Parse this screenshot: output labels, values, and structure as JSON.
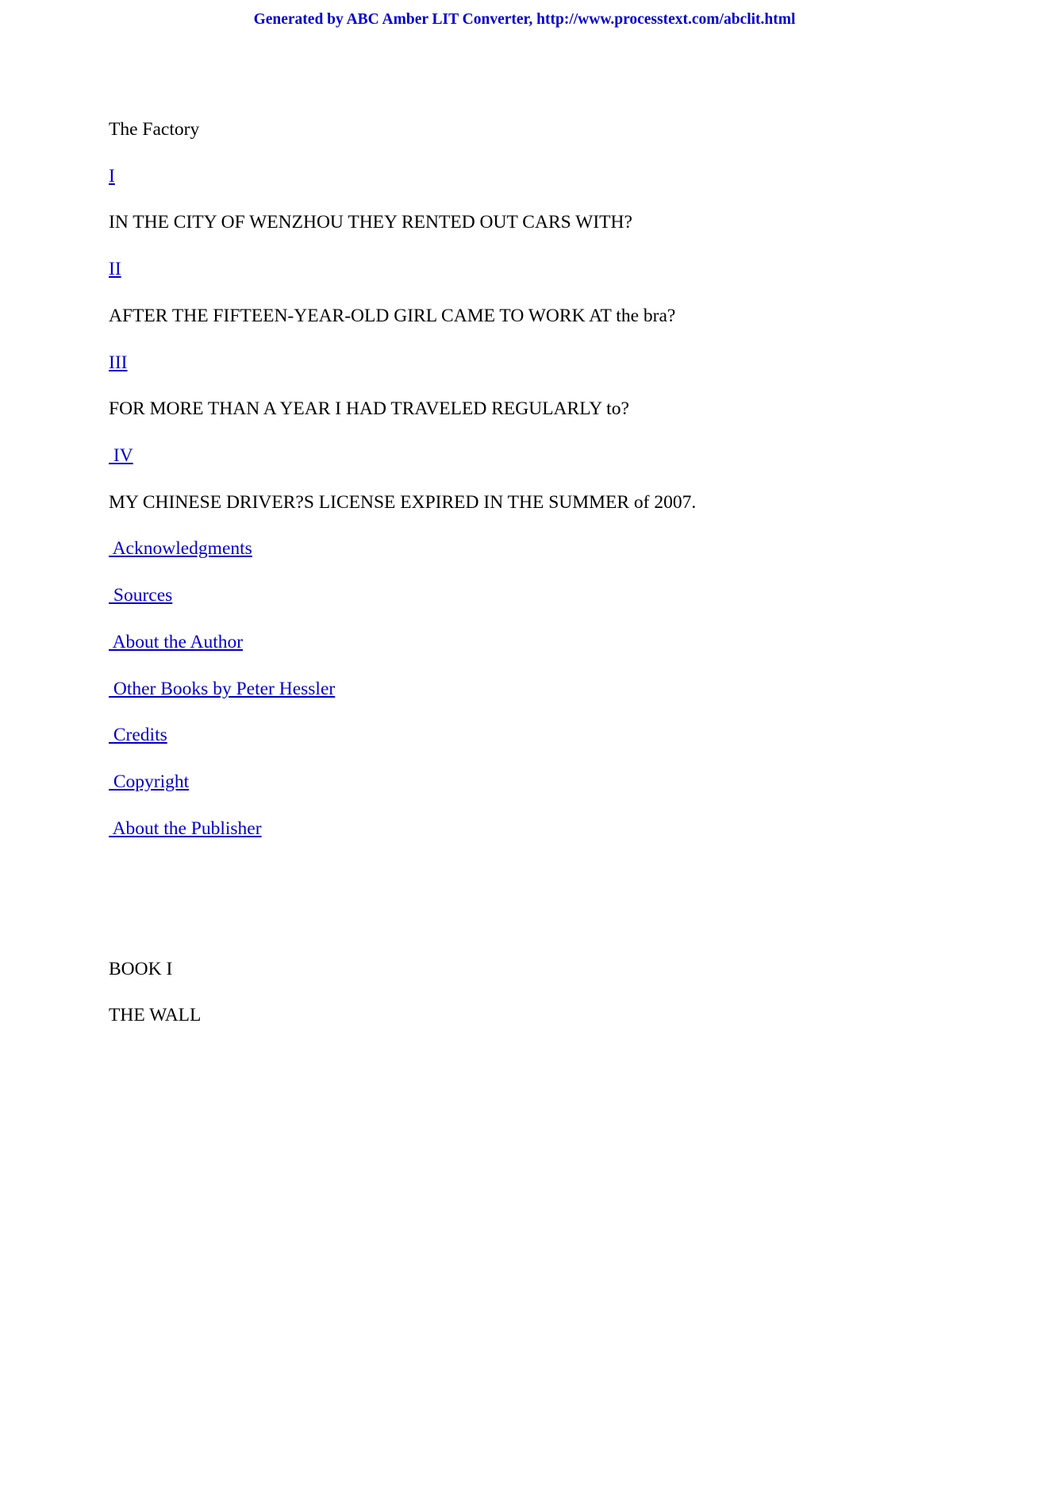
{
  "header": {
    "banner_text": "Generated by ABC Amber LIT Converter, http://www.processtext.com/abclit.html",
    "banner_color": "#0000cc"
  },
  "document": {
    "title": "The Factory",
    "link_color": "#0000cc",
    "text_color": "#000000",
    "background_color": "#ffffff",
    "toc": [
      {
        "link": "I",
        "summary": "IN THE CITY OF WENZHOU THEY RENTED OUT CARS WITH?"
      },
      {
        "link": "II",
        "summary": "AFTER THE FIFTEEN-YEAR-OLD GIRL CAME TO WORK AT the bra?"
      },
      {
        "link": "III",
        "summary": "FOR MORE THAN A YEAR I HAD TRAVELED REGULARLY to?"
      },
      {
        "link": " IV",
        "summary": "MY CHINESE DRIVER?S LICENSE EXPIRED IN THE SUMMER of 2007."
      }
    ],
    "back_matter_links": [
      " Acknowledgments",
      " Sources",
      " About the Author",
      " Other Books by Peter Hessler",
      " Credits",
      " Copyright",
      " About the Publisher"
    ],
    "book_heading": "BOOK I",
    "book_subheading": "THE WALL"
  }
}
